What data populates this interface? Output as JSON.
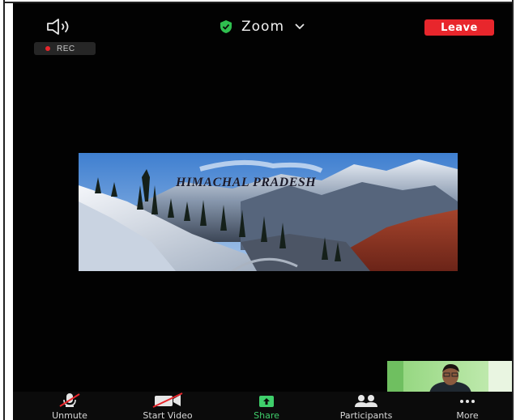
{
  "header": {
    "meeting_title": "Zoom",
    "leave_label": "Leave",
    "speaker_icon": "speaker-icon",
    "security_icon": "shield-check-icon",
    "dropdown_icon": "chevron-down-icon"
  },
  "recording": {
    "label": "REC",
    "dot_color": "#e8262c"
  },
  "shared_content": {
    "title_text": "HIMACHAL PRADESH"
  },
  "toolbar": {
    "items": [
      {
        "label": "Unmute",
        "icon": "microphone-muted-icon"
      },
      {
        "label": "Start Video",
        "icon": "video-off-icon"
      },
      {
        "label": "Share",
        "icon": "share-arrow-icon"
      },
      {
        "label": "Participants",
        "icon": "participants-icon"
      },
      {
        "label": "More",
        "icon": "more-dots-icon"
      }
    ]
  },
  "colors": {
    "leave": "#e8262c",
    "share_accent": "#3fcf6b",
    "background": "#020202"
  }
}
